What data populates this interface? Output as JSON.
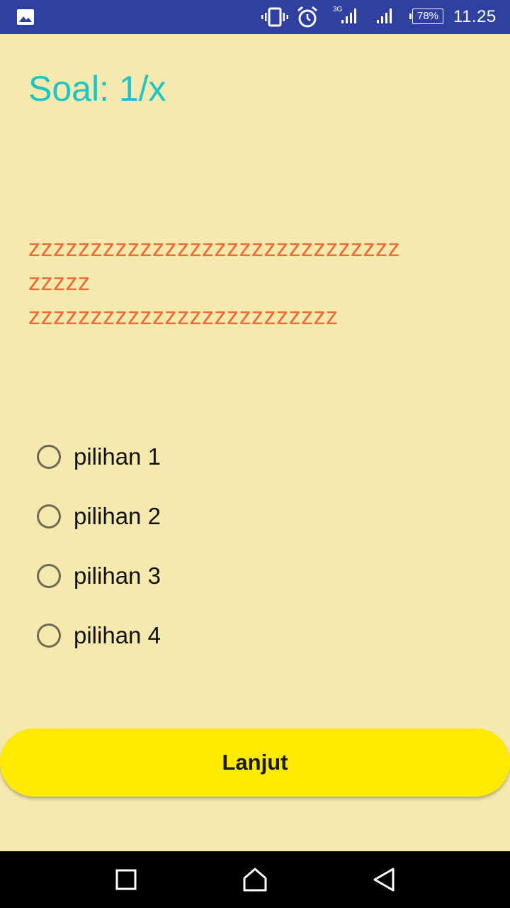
{
  "status_bar": {
    "battery_percent": "78%",
    "time": "11.25",
    "network_type": "3G",
    "icons": [
      "gallery-icon",
      "vibrate-icon",
      "alarm-icon",
      "signal-3g-icon",
      "signal-icon",
      "battery-icon"
    ]
  },
  "quiz": {
    "counter": "Soal: 1/x",
    "question_lines": [
      "zzzzzzzzzzzzzzzzzzzzzzzzzzzzzz",
      "zzzzz",
      "zzzzzzzzzzzzzzzzzzzzzzzzz"
    ],
    "options": [
      {
        "label": "pilihan 1",
        "selected": false
      },
      {
        "label": "pilihan 2",
        "selected": false
      },
      {
        "label": "pilihan 3",
        "selected": false
      },
      {
        "label": "pilihan 4",
        "selected": false
      }
    ],
    "next_label": "Lanjut"
  },
  "nav_bar": {
    "icons": [
      "recents-icon",
      "home-icon",
      "back-icon"
    ]
  },
  "colors": {
    "background": "#f5e9ad",
    "status_bar": "#3040a0",
    "counter": "#1cc4c7",
    "question": "#f06a35",
    "button": "#feea00"
  }
}
